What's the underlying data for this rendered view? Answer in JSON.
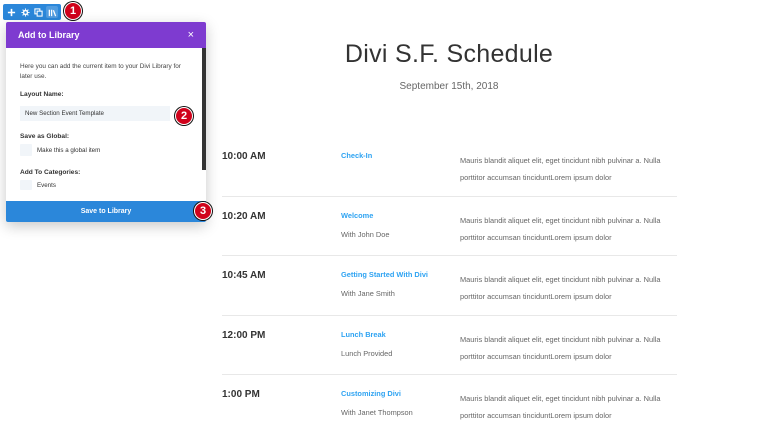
{
  "toolbar": {
    "buttons": [
      {
        "name": "add-icon",
        "glyph": "+"
      },
      {
        "name": "gear-icon",
        "glyph": "gear"
      },
      {
        "name": "duplicate-icon",
        "glyph": "dup"
      },
      {
        "name": "library-icon",
        "glyph": "lib"
      }
    ],
    "color": "#2b87da"
  },
  "badges": [
    "1",
    "2",
    "3"
  ],
  "modal": {
    "title": "Add to Library",
    "close_glyph": "×",
    "intro": "Here you can add the current item to your Divi Library for later use.",
    "layout_name_label": "Layout Name:",
    "layout_name_value": "New Section Event Template",
    "save_global_label": "Save as Global:",
    "save_global_checkbox": "Make this a global item",
    "categories_label": "Add To Categories:",
    "category_events": "Events",
    "save_button": "Save to Library",
    "header_color": "#7e3bd0",
    "footer_color": "#2b87da"
  },
  "page": {
    "title": "Divi S.F. Schedule",
    "date": "September 15th, 2018"
  },
  "schedule": [
    {
      "time": "10:00 AM",
      "event": "Check-In",
      "speaker": "",
      "desc": "Mauris blandit aliquet elit, eget tincidunt nibh pulvinar a. Nulla porttitor accumsan tinciduntLorem ipsum dolor"
    },
    {
      "time": "10:20 AM",
      "event": "Welcome",
      "speaker": "With John Doe",
      "desc": "Mauris blandit aliquet elit, eget tincidunt nibh pulvinar a. Nulla porttitor accumsan tinciduntLorem ipsum dolor"
    },
    {
      "time": "10:45 AM",
      "event": "Getting Started With Divi",
      "speaker": "With Jane Smith",
      "desc": "Mauris blandit aliquet elit, eget tincidunt nibh pulvinar a. Nulla porttitor accumsan tinciduntLorem ipsum dolor"
    },
    {
      "time": "12:00 PM",
      "event": "Lunch Break",
      "speaker": "Lunch Provided",
      "desc": "Mauris blandit aliquet elit, eget tincidunt nibh pulvinar a. Nulla porttitor accumsan tinciduntLorem ipsum dolor"
    },
    {
      "time": "1:00 PM",
      "event": "Customizing Divi",
      "speaker": "With Janet Thompson",
      "desc": "Mauris blandit aliquet elit, eget tincidunt nibh pulvinar a. Nulla porttitor accumsan tinciduntLorem ipsum dolor"
    }
  ],
  "colors": {
    "accent": "#2ea3f2",
    "badge": "#d0021b"
  }
}
